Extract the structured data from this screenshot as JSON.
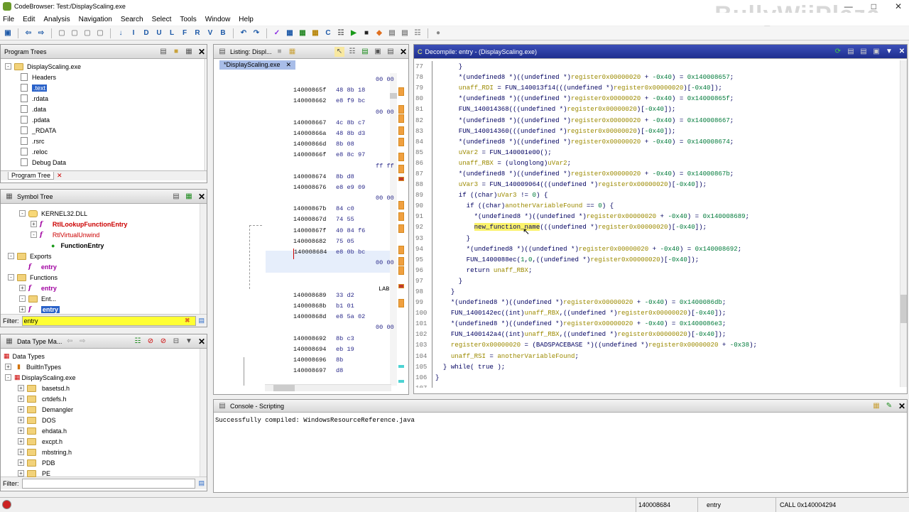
{
  "window": {
    "title": "CodeBrowser: Test:/DisplayScaling.exe",
    "watermark": "BullyWiiPlaza"
  },
  "menu": [
    "File",
    "Edit",
    "Analysis",
    "Navigation",
    "Search",
    "Select",
    "Tools",
    "Window",
    "Help"
  ],
  "toolbar_letters": [
    "I",
    "D",
    "U",
    "L",
    "F",
    "R",
    "V",
    "B"
  ],
  "program_trees": {
    "title": "Program Trees",
    "root": "DisplayScaling.exe",
    "items": [
      "Headers",
      ".text",
      ".rdata",
      ".data",
      ".pdata",
      "_RDATA",
      ".rsrc",
      ".reloc",
      "Debug Data"
    ],
    "selected": ".text",
    "tab": "Program Tree"
  },
  "symbol_tree": {
    "title": "Symbol Tree",
    "items": [
      {
        "label": "KERNEL32.DLL",
        "level": 1,
        "kind": "dll",
        "exp": "-"
      },
      {
        "label": "RtlLookupFunctionEntry",
        "level": 2,
        "kind": "imp",
        "exp": "+"
      },
      {
        "label": "RtlVirtualUnwind",
        "level": 2,
        "kind": "imp2",
        "exp": "-"
      },
      {
        "label": "FunctionEntry",
        "level": 3,
        "kind": "param",
        "exp": ""
      },
      {
        "label": "Exports",
        "level": 0,
        "kind": "folder",
        "exp": "-"
      },
      {
        "label": "entry",
        "level": 1,
        "kind": "func",
        "exp": ""
      },
      {
        "label": "Functions",
        "level": 0,
        "kind": "folder",
        "exp": "-"
      },
      {
        "label": "entry",
        "level": 1,
        "kind": "func",
        "exp": "+"
      },
      {
        "label": "Ent...",
        "level": 1,
        "kind": "folder",
        "exp": "-"
      },
      {
        "label": "entry",
        "level": 1,
        "kind": "funcsel",
        "exp": "+"
      }
    ],
    "filter_label": "Filter:",
    "filter_value": "entry"
  },
  "data_types": {
    "title": "Data Type Ma...",
    "root": "Data Types",
    "builtin": "BuiltInTypes",
    "program": "DisplayScaling.exe",
    "folders": [
      "basetsd.h",
      "crtdefs.h",
      "Demangler",
      "DOS",
      "ehdata.h",
      "excpt.h",
      "mbstring.h",
      "PDB",
      "PE"
    ],
    "filter_label": "Filter:",
    "filter_value": ""
  },
  "listing": {
    "title": "Listing: Displ...",
    "tab": "*DisplayScaling.exe",
    "label_fragment": "LAB",
    "rows": [
      {
        "addr": "",
        "bytes": "00 00"
      },
      {
        "addr": "14000865f",
        "bytes": "48 8b 18"
      },
      {
        "addr": "140008662",
        "bytes": "e8 f9 bc"
      },
      {
        "addr": "",
        "bytes": "00 00"
      },
      {
        "addr": "140008667",
        "bytes": "4c 8b c7"
      },
      {
        "addr": "14000866a",
        "bytes": "48 8b d3"
      },
      {
        "addr": "14000866d",
        "bytes": "8b 08"
      },
      {
        "addr": "14000866f",
        "bytes": "e8 8c 97"
      },
      {
        "addr": "",
        "bytes": "ff ff"
      },
      {
        "addr": "140008674",
        "bytes": "8b d8"
      },
      {
        "addr": "140008676",
        "bytes": "e8 e9 09"
      },
      {
        "addr": "",
        "bytes": "00 00"
      },
      {
        "addr": "14000867b",
        "bytes": "84 c0"
      },
      {
        "addr": "14000867d",
        "bytes": "74 55"
      },
      {
        "addr": "14000867f",
        "bytes": "40 84 f6"
      },
      {
        "addr": "140008682",
        "bytes": "75 05"
      },
      {
        "addr": "140008684",
        "bytes": "e8 0b bc"
      },
      {
        "addr": "",
        "bytes": "00 00"
      },
      {
        "addr": "",
        "bytes": ""
      },
      {
        "addr": "",
        "bytes": ""
      },
      {
        "addr": "140008689",
        "bytes": "33 d2"
      },
      {
        "addr": "14000868b",
        "bytes": "b1 01"
      },
      {
        "addr": "14000868d",
        "bytes": "e8 5a 02"
      },
      {
        "addr": "",
        "bytes": "00 00"
      },
      {
        "addr": "140008692",
        "bytes": "8b c3"
      },
      {
        "addr": "140008694",
        "bytes": "eb 19"
      },
      {
        "addr": "140008696",
        "bytes": "8b"
      },
      {
        "addr": "140008697",
        "bytes": "d8"
      }
    ]
  },
  "decompile": {
    "title": "Decompile: entry -  (DisplayScaling.exe)",
    "lines": [
      {
        "n": "77",
        "t": [
          [
            "      }",
            "t"
          ]
        ]
      },
      {
        "n": "78",
        "t": [
          [
            "      *(undefined8 *)((undefined *)",
            "t"
          ],
          [
            "register0x00000020",
            "v"
          ],
          [
            " + ",
            "t"
          ],
          [
            "-0x40",
            "c"
          ],
          [
            ") = ",
            "t"
          ],
          [
            "0x140008657",
            "c"
          ],
          [
            ";",
            "t"
          ]
        ]
      },
      {
        "n": "79",
        "t": [
          [
            "      ",
            "t"
          ],
          [
            "unaff_RDI",
            "v"
          ],
          [
            " = FUN_140013f14(((undefined *)",
            "t"
          ],
          [
            "register0x00000020",
            "v"
          ],
          [
            ")[",
            "t"
          ],
          [
            "-0x40",
            "c"
          ],
          [
            "]);",
            "t"
          ]
        ]
      },
      {
        "n": "80",
        "t": [
          [
            "      *(undefined8 *)((undefined *)",
            "t"
          ],
          [
            "register0x00000020",
            "v"
          ],
          [
            " + ",
            "t"
          ],
          [
            "-0x40",
            "c"
          ],
          [
            ") = ",
            "t"
          ],
          [
            "0x14000865f",
            "c"
          ],
          [
            ";",
            "t"
          ]
        ]
      },
      {
        "n": "81",
        "t": [
          [
            "      FUN_140014368(((undefined *)",
            "t"
          ],
          [
            "register0x00000020",
            "v"
          ],
          [
            ")[",
            "t"
          ],
          [
            "-0x40",
            "c"
          ],
          [
            "]);",
            "t"
          ]
        ]
      },
      {
        "n": "82",
        "t": [
          [
            "      *(undefined8 *)((undefined *)",
            "t"
          ],
          [
            "register0x00000020",
            "v"
          ],
          [
            " + ",
            "t"
          ],
          [
            "-0x40",
            "c"
          ],
          [
            ") = ",
            "t"
          ],
          [
            "0x140008667",
            "c"
          ],
          [
            ";",
            "t"
          ]
        ]
      },
      {
        "n": "83",
        "t": [
          [
            "      FUN_140014360(((undefined *)",
            "t"
          ],
          [
            "register0x00000020",
            "v"
          ],
          [
            ")[",
            "t"
          ],
          [
            "-0x40",
            "c"
          ],
          [
            "]);",
            "t"
          ]
        ]
      },
      {
        "n": "84",
        "t": [
          [
            "      *(undefined8 *)((undefined *)",
            "t"
          ],
          [
            "register0x00000020",
            "v"
          ],
          [
            " + ",
            "t"
          ],
          [
            "-0x40",
            "c"
          ],
          [
            ") = ",
            "t"
          ],
          [
            "0x140008674",
            "c"
          ],
          [
            ";",
            "t"
          ]
        ]
      },
      {
        "n": "85",
        "t": [
          [
            "      ",
            "t"
          ],
          [
            "uVar2",
            "v"
          ],
          [
            " = FUN_140001e00();",
            "t"
          ]
        ]
      },
      {
        "n": "86",
        "t": [
          [
            "      ",
            "t"
          ],
          [
            "unaff_RBX",
            "v"
          ],
          [
            " = (ulonglong)",
            "t"
          ],
          [
            "uVar2",
            "v"
          ],
          [
            ";",
            "t"
          ]
        ]
      },
      {
        "n": "87",
        "t": [
          [
            "      *(undefined8 *)((undefined *)",
            "t"
          ],
          [
            "register0x00000020",
            "v"
          ],
          [
            " + ",
            "t"
          ],
          [
            "-0x40",
            "c"
          ],
          [
            ") = ",
            "t"
          ],
          [
            "0x14000867b",
            "c"
          ],
          [
            ";",
            "t"
          ]
        ]
      },
      {
        "n": "88",
        "t": [
          [
            "      ",
            "t"
          ],
          [
            "uVar3",
            "v"
          ],
          [
            " = FUN_140009064(((undefined *)",
            "t"
          ],
          [
            "register0x00000020",
            "v"
          ],
          [
            ")[",
            "t"
          ],
          [
            "-0x40",
            "c"
          ],
          [
            "]);",
            "t"
          ]
        ]
      },
      {
        "n": "89",
        "t": [
          [
            "      if ((char)",
            "t"
          ],
          [
            "uVar3",
            "v"
          ],
          [
            " != ",
            "t"
          ],
          [
            "0",
            "c"
          ],
          [
            ") {",
            "t"
          ]
        ]
      },
      {
        "n": "90",
        "t": [
          [
            "        if ((char)",
            "t"
          ],
          [
            "anotherVariableFound",
            "v"
          ],
          [
            " == ",
            "t"
          ],
          [
            "0",
            "c"
          ],
          [
            ") {",
            "t"
          ]
        ]
      },
      {
        "n": "91",
        "t": [
          [
            "          *(undefined8 *)((undefined *)",
            "t"
          ],
          [
            "register0x00000020",
            "v"
          ],
          [
            " + ",
            "t"
          ],
          [
            "-0x40",
            "c"
          ],
          [
            ") = ",
            "t"
          ],
          [
            "0x140008689",
            "c"
          ],
          [
            ";",
            "t"
          ]
        ]
      },
      {
        "n": "92",
        "t": [
          [
            "          ",
            "t"
          ],
          [
            "new_function_name",
            "h"
          ],
          [
            "(((undefined *)",
            "t"
          ],
          [
            "register0x00000020",
            "v"
          ],
          [
            ")[",
            "t"
          ],
          [
            "-0x40",
            "c"
          ],
          [
            "]);",
            "t"
          ]
        ]
      },
      {
        "n": "93",
        "t": [
          [
            "        }",
            "t"
          ]
        ]
      },
      {
        "n": "94",
        "t": [
          [
            "        *(undefined8 *)((undefined *)",
            "t"
          ],
          [
            "register0x00000020",
            "v"
          ],
          [
            " + ",
            "t"
          ],
          [
            "-0x40",
            "c"
          ],
          [
            ") = ",
            "t"
          ],
          [
            "0x140008692",
            "c"
          ],
          [
            ";",
            "t"
          ]
        ]
      },
      {
        "n": "95",
        "t": [
          [
            "        FUN_1400088ec(",
            "t"
          ],
          [
            "1",
            "c"
          ],
          [
            ",",
            "t"
          ],
          [
            "0",
            "c"
          ],
          [
            ",((undefined *)",
            "t"
          ],
          [
            "register0x00000020",
            "v"
          ],
          [
            ")[",
            "t"
          ],
          [
            "-0x40",
            "c"
          ],
          [
            "]);",
            "t"
          ]
        ]
      },
      {
        "n": "96",
        "t": [
          [
            "        return ",
            "t"
          ],
          [
            "unaff_RBX",
            "v"
          ],
          [
            ";",
            "t"
          ]
        ]
      },
      {
        "n": "97",
        "t": [
          [
            "      }",
            "t"
          ]
        ]
      },
      {
        "n": "98",
        "t": [
          [
            "    }",
            "t"
          ]
        ]
      },
      {
        "n": "99",
        "t": [
          [
            "    *(undefined8 *)((undefined *)",
            "t"
          ],
          [
            "register0x00000020",
            "v"
          ],
          [
            " + ",
            "t"
          ],
          [
            "-0x40",
            "c"
          ],
          [
            ") = ",
            "t"
          ],
          [
            "0x1400086db",
            "c"
          ],
          [
            ";",
            "t"
          ]
        ]
      },
      {
        "n": "100",
        "t": [
          [
            "    FUN_1400142ec((int)",
            "t"
          ],
          [
            "unaff_RBX",
            "v"
          ],
          [
            ",((undefined *)",
            "t"
          ],
          [
            "register0x00000020",
            "v"
          ],
          [
            ")[",
            "t"
          ],
          [
            "-0x40",
            "c"
          ],
          [
            "]);",
            "t"
          ]
        ]
      },
      {
        "n": "101",
        "t": [
          [
            "    *(undefined8 *)((undefined *)",
            "t"
          ],
          [
            "register0x00000020",
            "v"
          ],
          [
            " + ",
            "t"
          ],
          [
            "-0x40",
            "c"
          ],
          [
            ") = ",
            "t"
          ],
          [
            "0x1400086e3",
            "c"
          ],
          [
            ";",
            "t"
          ]
        ]
      },
      {
        "n": "102",
        "t": [
          [
            "    FUN_1400142a4((int)",
            "t"
          ],
          [
            "unaff_RBX",
            "v"
          ],
          [
            ",((undefined *)",
            "t"
          ],
          [
            "register0x00000020",
            "v"
          ],
          [
            ")[",
            "t"
          ],
          [
            "-0x40",
            "c"
          ],
          [
            "]);",
            "t"
          ]
        ]
      },
      {
        "n": "103",
        "t": [
          [
            "    ",
            "t"
          ],
          [
            "register0x00000020",
            "v"
          ],
          [
            " = (BADSPACEBASE *)((undefined *)",
            "t"
          ],
          [
            "register0x00000020",
            "v"
          ],
          [
            " + ",
            "t"
          ],
          [
            "-0x38",
            "c"
          ],
          [
            ");",
            "t"
          ]
        ]
      },
      {
        "n": "104",
        "t": [
          [
            "    ",
            "t"
          ],
          [
            "unaff_RSI",
            "v"
          ],
          [
            " = ",
            "t"
          ],
          [
            "anotherVariableFound",
            "v"
          ],
          [
            ";",
            "t"
          ]
        ]
      },
      {
        "n": "105",
        "t": [
          [
            "  } while( true );",
            "t"
          ]
        ]
      },
      {
        "n": "106",
        "t": [
          [
            "}",
            "t"
          ]
        ]
      },
      {
        "n": "107",
        "t": [
          [
            "",
            "t"
          ]
        ]
      }
    ]
  },
  "console": {
    "title": "Console - Scripting",
    "output": "Successfully compiled: WindowsResourceReference.java"
  },
  "status": {
    "address": "140008684",
    "function": "entry",
    "instruction": "CALL 0x140004294"
  }
}
